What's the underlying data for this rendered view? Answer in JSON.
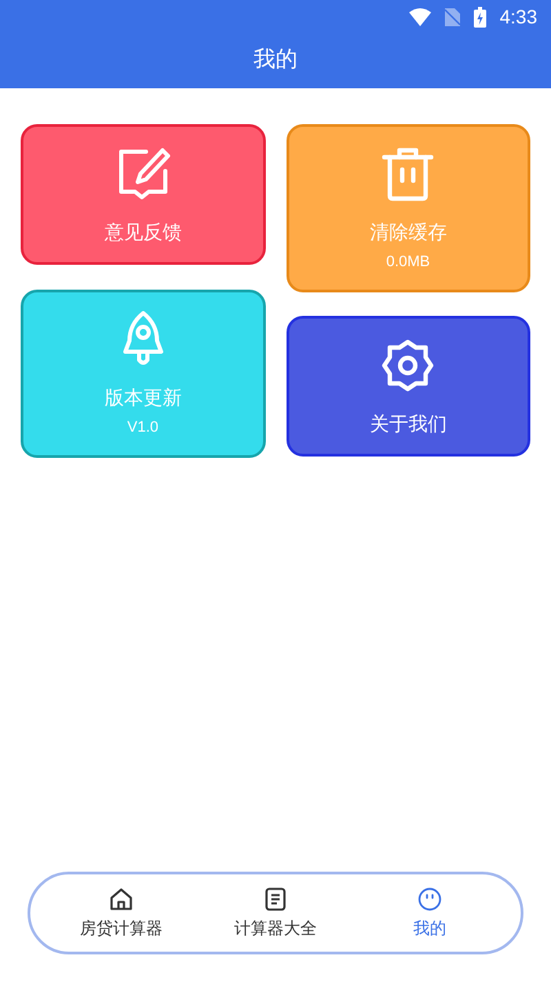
{
  "status_bar": {
    "time": "4:33"
  },
  "header": {
    "title": "我的"
  },
  "columns": [
    [
      {
        "kind": "feedback",
        "title": "意见反馈",
        "color": "#fe5a6e"
      },
      {
        "kind": "rocket",
        "title": "版本更新",
        "subtitle": "V1.0",
        "color": "#34dcec"
      }
    ],
    [
      {
        "kind": "trash",
        "title": "清除缓存",
        "subtitle": "0.0MB",
        "color": "#ffaa47"
      },
      {
        "kind": "gear",
        "title": "关于我们",
        "color": "#4b5ae0"
      }
    ]
  ],
  "bottom_nav": [
    {
      "kind": "home",
      "label": "房贷计算器",
      "selected": false
    },
    {
      "kind": "list",
      "label": "计算器大全",
      "selected": false
    },
    {
      "kind": "face",
      "label": "我的",
      "selected": true
    }
  ]
}
